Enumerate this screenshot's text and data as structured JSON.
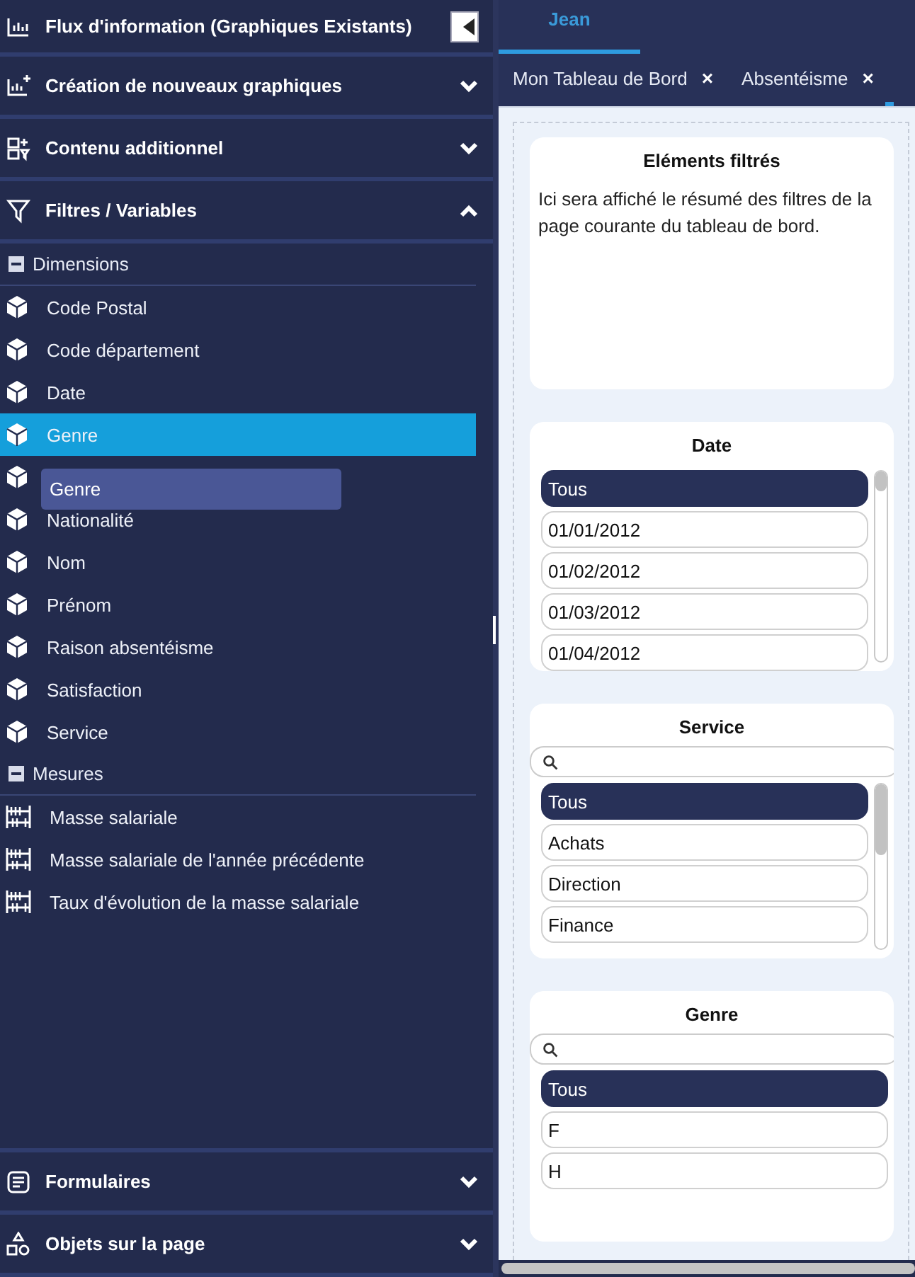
{
  "sidebar": {
    "collapse_button": true,
    "sections_top": [
      {
        "kind": "chart",
        "label": "Flux d'information (Graphiques Existants)"
      },
      {
        "kind": "chart-plus",
        "label": "Création de nouveaux graphiques",
        "expanded": false
      },
      {
        "kind": "content",
        "label": "Contenu additionnel",
        "expanded": false
      },
      {
        "kind": "filter",
        "label": "Filtres / Variables",
        "expanded": true
      }
    ],
    "tree": [
      {
        "kind": "dimension",
        "label": "Dimensions",
        "expanded": true,
        "children": [
          {
            "kind": "item",
            "label": "Code Postal",
            "selected": false
          },
          {
            "kind": "item",
            "label": "Code département",
            "selected": false
          },
          {
            "kind": "item",
            "label": "Date",
            "selected": false
          },
          {
            "kind": "item",
            "label": "Genre",
            "selected": true
          },
          {
            "kind": "covered",
            "selected": false
          },
          {
            "kind": "item",
            "label": "Nationalité",
            "selected": false
          },
          {
            "kind": "item",
            "label": "Nom",
            "selected": false
          },
          {
            "kind": "item",
            "label": "Prénom",
            "selected": false
          },
          {
            "kind": "item",
            "label": "Raison absentéisme",
            "selected": false
          },
          {
            "kind": "item",
            "label": "Satisfaction",
            "selected": false
          },
          {
            "kind": "item",
            "label": "Service",
            "selected": false
          }
        ]
      },
      {
        "kind": "measure",
        "label": "Mesures",
        "expanded": true,
        "children": [
          {
            "kind": "item",
            "label": "Masse salariale",
            "selected": false
          },
          {
            "kind": "item",
            "label": "Masse salariale de l'année précédente",
            "selected": false
          },
          {
            "kind": "item",
            "label": "Taux d'évolution de la masse salariale",
            "selected": false
          }
        ]
      }
    ],
    "drag_ghost": {
      "label": "Genre"
    },
    "sections_bottom": [
      {
        "kind": "form",
        "label": "Formulaires",
        "expanded": false
      },
      {
        "kind": "shapes",
        "label": "Objets sur la page",
        "expanded": false
      }
    ]
  },
  "user_tab": {
    "label": "Jean",
    "selected": true
  },
  "tabs": [
    {
      "label": "Mon Tableau de Bord",
      "close": "×"
    },
    {
      "label": "Absentéisme",
      "close": "×"
    }
  ],
  "cards": [
    {
      "kind": "text",
      "title": "Eléments filtrés",
      "text": "Ici sera affiché le résumé des filtres de la page courante du tableau de bord."
    },
    {
      "kind": "list",
      "title": "Date",
      "search": false,
      "items": [
        {
          "label": "Tous",
          "selected": true
        },
        {
          "label": "01/01/2012",
          "selected": false
        },
        {
          "label": "01/02/2012",
          "selected": false
        },
        {
          "label": "01/03/2012",
          "selected": false
        },
        {
          "label": "01/04/2012",
          "selected": false
        }
      ]
    },
    {
      "kind": "list",
      "title": "Service",
      "search": true,
      "items": [
        {
          "label": "Tous",
          "selected": true
        },
        {
          "label": "Achats",
          "selected": false
        },
        {
          "label": "Direction",
          "selected": false
        },
        {
          "label": "Finance",
          "selected": false
        }
      ]
    },
    {
      "kind": "list",
      "title": "Genre",
      "search": true,
      "items": [
        {
          "label": "Tous",
          "selected": true
        },
        {
          "label": "F",
          "selected": false
        },
        {
          "label": "H",
          "selected": false
        }
      ]
    }
  ]
}
